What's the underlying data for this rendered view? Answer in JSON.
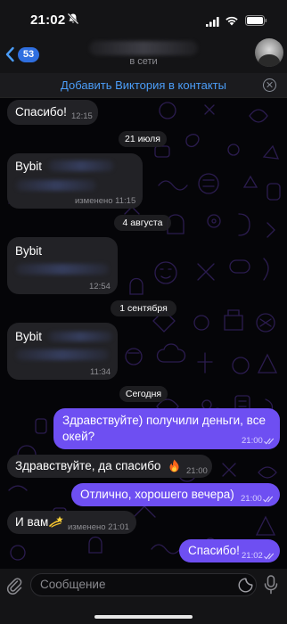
{
  "status_bar": {
    "time": "21:02"
  },
  "header": {
    "back_badge": "53",
    "contact_status": "в сети"
  },
  "banner": {
    "add_contact": "Добавить Виктория в контакты"
  },
  "messages": [
    {
      "text": "Спасибо!",
      "time": "12:15"
    },
    {
      "date": "21 июля"
    },
    {
      "text": "Bybit",
      "time": "изменено 11:15"
    },
    {
      "date": "4 августа"
    },
    {
      "text": "Bybit",
      "time": "12:54"
    },
    {
      "date": "1 сентября"
    },
    {
      "text": "Bybit",
      "time": "11:34"
    },
    {
      "date": "Сегодня"
    },
    {
      "text_line1": "Здравствуйте) получили деньги, все",
      "text_line2": "окей?",
      "time": "21:00"
    },
    {
      "text": "Здравствуйте, да спасибо",
      "time": "21:00"
    },
    {
      "text": "Отлично, хорошего вечера)",
      "time": "21:00"
    },
    {
      "text": "И вам",
      "time": "изменено 21:01"
    },
    {
      "text": "Спасибо!",
      "time": "21:02"
    }
  ],
  "input": {
    "placeholder": "Сообщение"
  },
  "icons": [
    "mute-icon",
    "signal-icon",
    "wifi-icon",
    "battery-icon",
    "back-chevron-icon",
    "avatar",
    "close-icon",
    "double-check-icon",
    "fire-emoji-icon",
    "dizzy-emoji-icon",
    "attach-icon",
    "sticker-icon",
    "microphone-icon"
  ],
  "colors": {
    "accent": "#4b9df8",
    "outgoing_bubble": "#6e4ff2",
    "incoming_bubble": "#222226",
    "badge": "#2f6fe0"
  }
}
